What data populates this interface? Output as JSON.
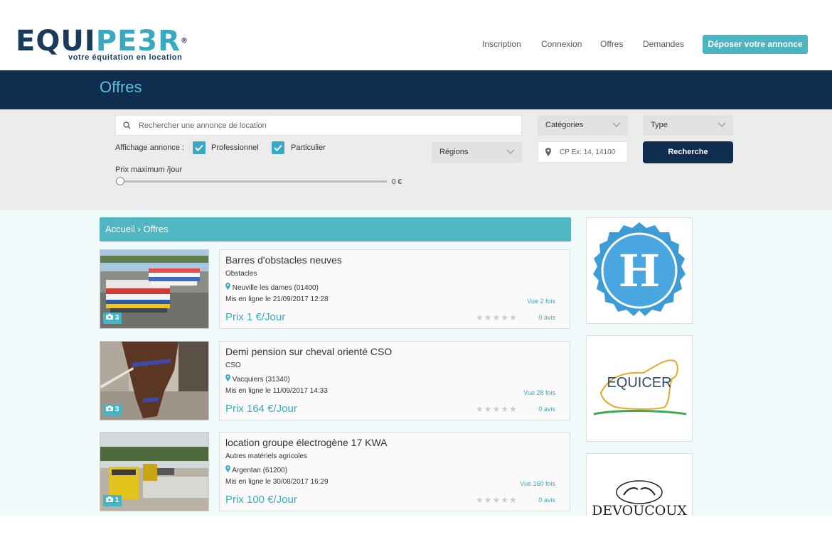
{
  "brand": {
    "part1": "EQUI",
    "part2": "PE3R",
    "registered": "®",
    "tagline": "votre équitation en location"
  },
  "nav": {
    "inscription": "Inscription",
    "connexion": "Connexion",
    "offres": "Offres",
    "demandes": "Demandes",
    "post_button": "Déposer votre annonce"
  },
  "page_title": "Offres",
  "filters": {
    "search_placeholder": "Rechercher une annonce de location",
    "categories": "Catégories",
    "type": "Type",
    "display_label": "Affichage annonce :",
    "professionnel": "Professionnel",
    "particulier": "Particulier",
    "regions": "Régions",
    "cp_placeholder": "CP Ex: 14, 14100",
    "search_button": "Recherche",
    "price_label": "Prix maximum /jour",
    "price_value": "0 €",
    "price_slider_fraction": 0
  },
  "breadcrumb": "Accueil › Offres",
  "listings": [
    {
      "photos": "3",
      "title": "Barres d'obstacles neuves",
      "category": "Obstacles",
      "location": "Neuville les dames (01400)",
      "date": "Mis en ligne le 21/09/2017 12:28",
      "views": "Vue 2 fois",
      "price": "Prix 1 €/Jour",
      "stars": "★★★★★",
      "reviews": "0 avis"
    },
    {
      "photos": "3",
      "title": "Demi pension sur cheval orienté CSO",
      "category": "CSO",
      "location": "Vacquiers (31340)",
      "date": "Mis en ligne le 11/09/2017 14:33",
      "views": "Vue 28 fois",
      "price": "Prix 164 €/Jour",
      "stars": "★★★★★",
      "reviews": "0 avis"
    },
    {
      "photos": "1",
      "title": "location groupe électrogène 17 KWA",
      "category": "Autres matériels agricoles",
      "location": "Argentan (61200)",
      "date": "Mis en ligne le 30/08/2017 16:29",
      "views": "Vue 160 fois",
      "price": "Prix 100 €/Jour",
      "stars": "★★★★★",
      "reviews": "0 avis"
    }
  ],
  "ads": {
    "badge_letter": "H",
    "equicer": "EQUICER",
    "devoucoux": "DEVOUCOUX"
  },
  "colors": {
    "navy": "#0f2d4e",
    "teal": "#4fb6c2",
    "accent": "#3aa9bf"
  },
  "icons": {
    "search": "search-icon",
    "chevron": "chevron-down-icon",
    "check": "check-icon",
    "pin": "map-pin-icon",
    "camera": "camera-icon"
  }
}
